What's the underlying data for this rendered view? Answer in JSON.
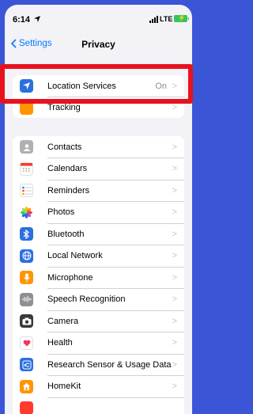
{
  "status": {
    "time": "6:14",
    "network": "LTE"
  },
  "nav": {
    "back_label": "Settings",
    "title": "Privacy"
  },
  "group1": [
    {
      "label": "Location Services",
      "value": "On",
      "icon": "location-arrow-icon",
      "color": "#2c6fe0"
    },
    {
      "label": "Tracking",
      "value": "",
      "icon": "tracking-icon",
      "color": "#ff9500"
    }
  ],
  "group2": [
    {
      "label": "Contacts",
      "icon": "contacts-icon",
      "color": "#a8a8a8"
    },
    {
      "label": "Calendars",
      "icon": "calendar-icon",
      "color": "#ffffff"
    },
    {
      "label": "Reminders",
      "icon": "reminders-icon",
      "color": "#ffffff"
    },
    {
      "label": "Photos",
      "icon": "photos-icon",
      "color": "#ffffff"
    },
    {
      "label": "Bluetooth",
      "icon": "bluetooth-icon",
      "color": "#2c6fe0"
    },
    {
      "label": "Local Network",
      "icon": "globe-icon",
      "color": "#2c6fe0"
    },
    {
      "label": "Microphone",
      "icon": "microphone-icon",
      "color": "#ff9500"
    },
    {
      "label": "Speech Recognition",
      "icon": "waveform-icon",
      "color": "#8e8e93"
    },
    {
      "label": "Camera",
      "icon": "camera-icon",
      "color": "#3a3a3c"
    },
    {
      "label": "Health",
      "icon": "heart-icon",
      "color": "#ffffff"
    },
    {
      "label": "Research Sensor & Usage Data",
      "icon": "research-icon",
      "color": "#2c6fe0"
    },
    {
      "label": "HomeKit",
      "icon": "home-icon",
      "color": "#ff9500"
    }
  ]
}
